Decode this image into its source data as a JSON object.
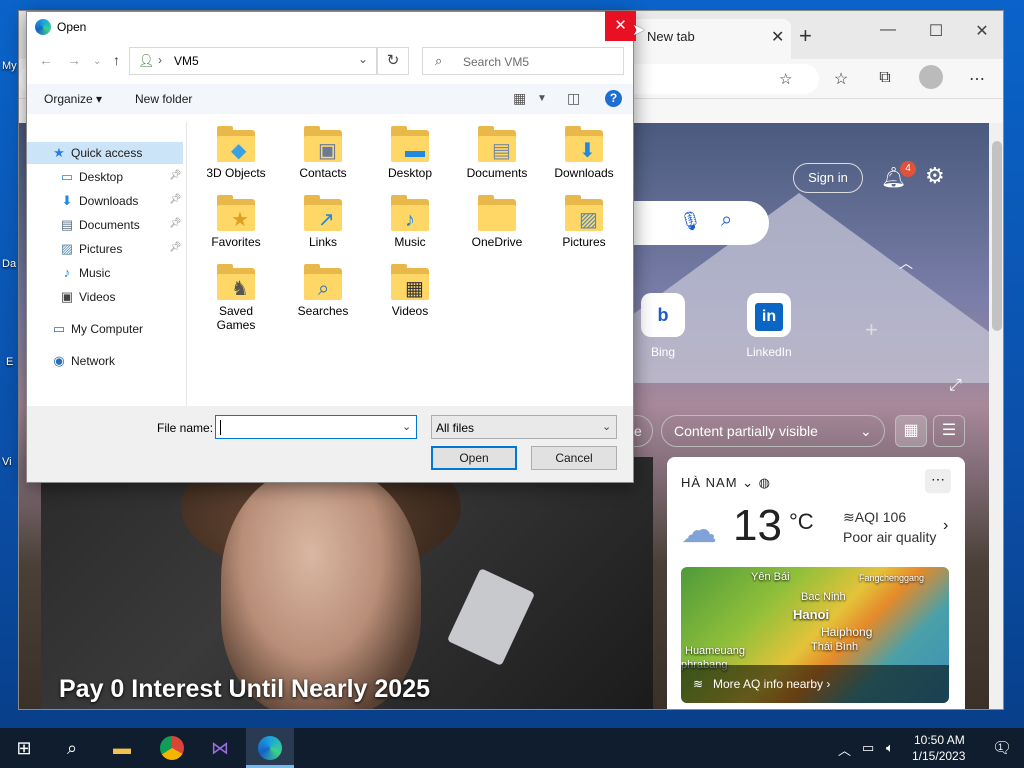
{
  "desktop": {
    "label_slivers": [
      "My",
      "Da",
      "E",
      "Vi"
    ]
  },
  "edge": {
    "tab_title": "New tab",
    "tab_close": "✕",
    "new_tab": "+",
    "win_min": "—",
    "win_max": "☐",
    "win_close": "✕",
    "sign_in": "Sign in",
    "notif_count": "4",
    "quick_links": [
      {
        "label": "Bing",
        "glyph": "b",
        "color": "#1a5bd0"
      },
      {
        "label": "LinkedIn",
        "glyph": "in",
        "color": "#0a66c2"
      }
    ],
    "chip_partial": "e",
    "content_filter": "Content partially visible",
    "news_headline": "Pay 0 Interest Until Nearly 2025",
    "weather": {
      "location": "HÀ NAM",
      "temperature": "13",
      "unit": "°C",
      "aqi": "AQI 106",
      "aqi_status": "Poor air quality",
      "cities": [
        "Yên Bái",
        "Fangchenggang",
        "Bac Ninh",
        "Hanoi",
        "Haiphong",
        "Thái Bình",
        "Huameuang",
        "phrabang"
      ],
      "aq_link": "More AQ info nearby"
    }
  },
  "dialog": {
    "title": "Open",
    "close": "✕",
    "path_segment": "VM5",
    "search_placeholder": "Search VM5",
    "organize": "Organize ▾",
    "new_folder": "New folder",
    "nav": [
      {
        "label": "Quick access",
        "icon": "★",
        "color": "#2c7be5",
        "pinned": false,
        "selected": true,
        "indent": 1
      },
      {
        "label": "Desktop",
        "icon": "▭",
        "color": "#1e88e5",
        "pinned": true,
        "indent": 2
      },
      {
        "label": "Downloads",
        "icon": "⬇",
        "color": "#1e88e5",
        "pinned": true,
        "indent": 2
      },
      {
        "label": "Documents",
        "icon": "▤",
        "color": "#5a6f8a",
        "pinned": true,
        "indent": 2
      },
      {
        "label": "Pictures",
        "icon": "▨",
        "color": "#5a8ab0",
        "pinned": true,
        "indent": 2
      },
      {
        "label": "Music",
        "icon": "♪",
        "color": "#1e88e5",
        "pinned": false,
        "indent": 2
      },
      {
        "label": "Videos",
        "icon": "▣",
        "color": "#444",
        "pinned": false,
        "indent": 2
      },
      {
        "label": "My Computer",
        "icon": "▭",
        "color": "#2a6fb5",
        "pinned": false,
        "indent": 1
      },
      {
        "label": "Network",
        "icon": "◉",
        "color": "#2a6fb5",
        "pinned": false,
        "indent": 1
      }
    ],
    "folders": [
      {
        "label": "3D Objects",
        "overlay": "◆",
        "color": "#3aa0e0"
      },
      {
        "label": "Contacts",
        "overlay": "▣",
        "color": "#6a7a9a"
      },
      {
        "label": "Desktop",
        "overlay": "▬",
        "color": "#1e88e5"
      },
      {
        "label": "Documents",
        "overlay": "▤",
        "color": "#7a8aa0"
      },
      {
        "label": "Downloads",
        "overlay": "⬇",
        "color": "#1e88e5"
      },
      {
        "label": "Favorites",
        "overlay": "★",
        "color": "#e0a020"
      },
      {
        "label": "Links",
        "overlay": "↗",
        "color": "#1e88e5"
      },
      {
        "label": "Music",
        "overlay": "♪",
        "color": "#1e88e5"
      },
      {
        "label": "OneDrive",
        "overlay": "",
        "color": "#1e88e5"
      },
      {
        "label": "Pictures",
        "overlay": "▨",
        "color": "#5a8ab0"
      },
      {
        "label": "Saved Games",
        "overlay": "♞",
        "color": "#555"
      },
      {
        "label": "Searches",
        "overlay": "⌕",
        "color": "#2a6fb5"
      },
      {
        "label": "Videos",
        "overlay": "▦",
        "color": "#333"
      }
    ],
    "file_name_label": "File name:",
    "file_name_value": "",
    "file_type": "All files",
    "open_button": "Open",
    "cancel_button": "Cancel"
  },
  "taskbar": {
    "time": "10:50 AM",
    "date": "1/15/2023",
    "notification_count": "1"
  }
}
